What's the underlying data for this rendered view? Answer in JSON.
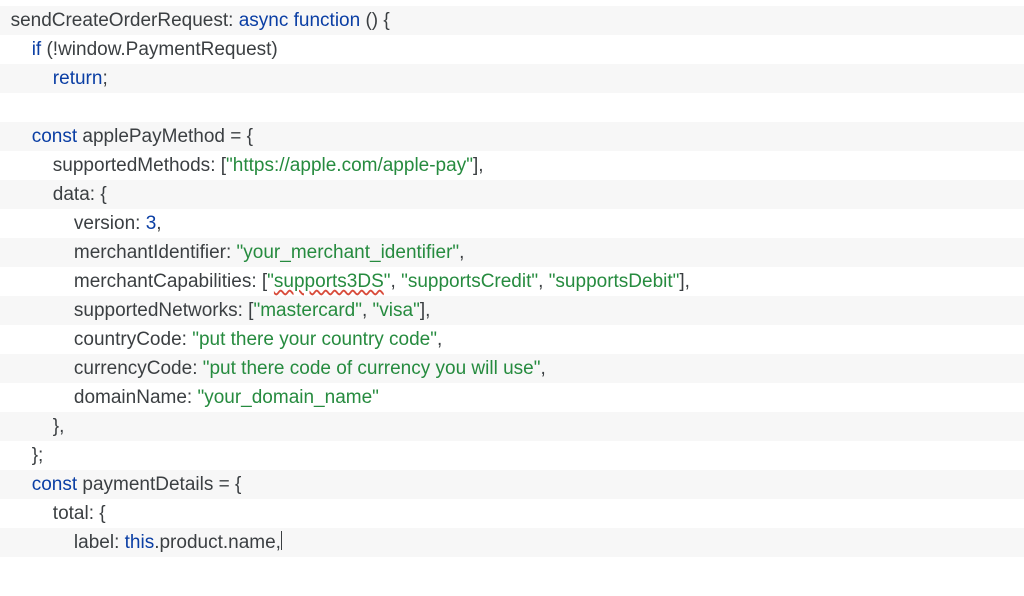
{
  "code": {
    "fn_name": "sendCreateOrderRequest",
    "kw_async": "async",
    "kw_function": "function",
    "kw_if": "if",
    "cond": "(!window.PaymentRequest)",
    "kw_return": "return",
    "kw_const1": "const",
    "applePayMethod": "applePayMethod",
    "supportedMethods_key": "supportedMethods",
    "supportedMethods_val": "\"https://apple.com/apple-pay\"",
    "data_key": "data",
    "version_key": "version",
    "version_val": "3",
    "merchantIdentifier_key": "merchantIdentifier",
    "merchantIdentifier_val": "\"your_merchant_identifier\"",
    "merchantCapabilities_key": "merchantCapabilities",
    "mc_open": "[\"",
    "mc_spell": "supports3DS",
    "mc_close1": "\"",
    "mc_sep": ", ",
    "mc_val2": "\"supportsCredit\"",
    "mc_val3": "\"supportsDebit\"",
    "supportedNetworks_key": "supportedNetworks",
    "sn_val1": "\"mastercard\"",
    "sn_val2": "\"visa\"",
    "countryCode_key": "countryCode",
    "countryCode_val": "\"put there your country code\"",
    "currencyCode_key": "currencyCode",
    "currencyCode_val": "\"put there code of currency you will use\"",
    "domainName_key": "domainName",
    "domainName_val": "\"your_domain_name\"",
    "kw_const2": "const",
    "paymentDetails": "paymentDetails",
    "total_key": "total",
    "label_key": "label",
    "kw_this": "this",
    "product_name": ".product.name,"
  }
}
